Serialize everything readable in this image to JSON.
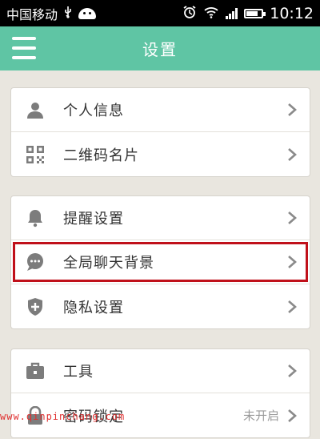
{
  "status_bar": {
    "carrier": "中国移动",
    "time": "10:12"
  },
  "header": {
    "title": "设置"
  },
  "groups": [
    {
      "items": [
        {
          "label": "个人信息",
          "icon": "person-icon"
        },
        {
          "label": "二维码名片",
          "icon": "qr-code-icon"
        }
      ]
    },
    {
      "items": [
        {
          "label": "提醒设置",
          "icon": "bell-icon"
        },
        {
          "label": "全局聊天背景",
          "icon": "chat-bubble-icon",
          "highlighted": true
        },
        {
          "label": "隐私设置",
          "icon": "shield-icon"
        }
      ]
    },
    {
      "items": [
        {
          "label": "工具",
          "icon": "toolbox-icon"
        },
        {
          "label": "密码锁定",
          "icon": "lock-icon",
          "value": "未开启"
        }
      ]
    }
  ],
  "watermark": "www.qinpinchang.com",
  "colors": {
    "header": "#5fc5a4",
    "background": "#e9e6df",
    "icon": "#7c7c7c",
    "highlight": "#c0101a"
  }
}
